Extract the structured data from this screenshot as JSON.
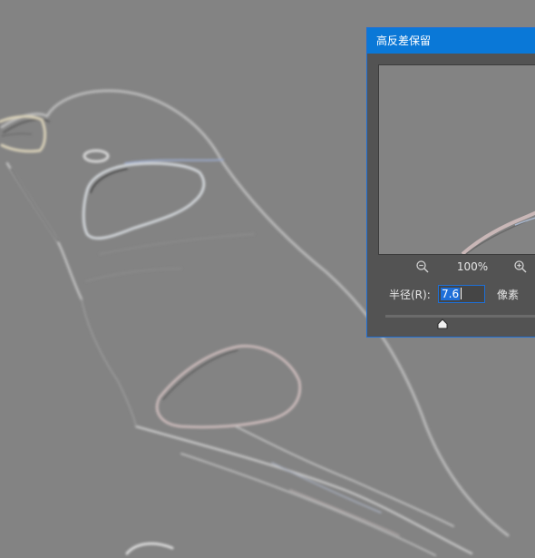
{
  "dialog": {
    "title": "高反差保留",
    "zoom_level": "100%",
    "radius_label": "半径(R):",
    "radius_value": "7.6",
    "unit_label": "像素",
    "radius_slider_position": 0.35
  },
  "icons": {
    "zoom_out": "zoom-out-icon",
    "zoom_in": "zoom-in-icon"
  },
  "colors": {
    "title_bar": "#0a78d7",
    "dialog_bg": "#535353",
    "canvas_gray": "#838383",
    "selection": "#1f6fd8"
  }
}
